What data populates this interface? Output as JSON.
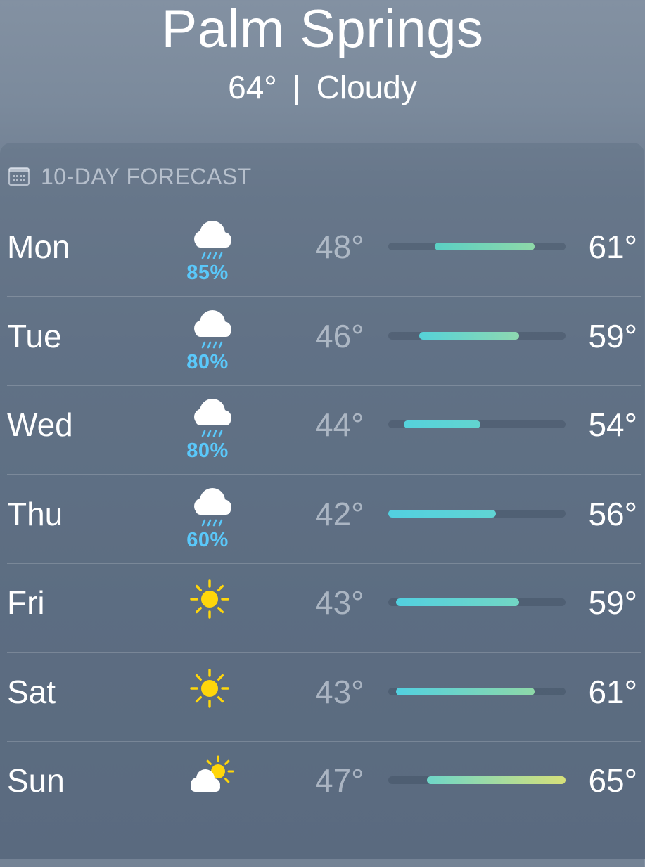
{
  "location": {
    "city": "Palm Springs",
    "temp": "64°",
    "separator": "|",
    "condition": "Cloudy"
  },
  "forecast": {
    "title": "10-DAY FORECAST",
    "title_icon": "calendar-icon",
    "range_low": 42,
    "range_high": 65,
    "days": [
      {
        "day": "Mon",
        "icon": "cloud-rain-icon",
        "precip": "85%",
        "low": "48°",
        "high": "61°",
        "low_val": 48,
        "high_val": 61,
        "colors": [
          "#5ad0c4",
          "#8ed8a8"
        ]
      },
      {
        "day": "Tue",
        "icon": "cloud-rain-icon",
        "precip": "80%",
        "low": "46°",
        "high": "59°",
        "low_val": 46,
        "high_val": 59,
        "colors": [
          "#55d2d8",
          "#8ed8b0"
        ]
      },
      {
        "day": "Wed",
        "icon": "cloud-rain-icon",
        "precip": "80%",
        "low": "44°",
        "high": "54°",
        "low_val": 44,
        "high_val": 54,
        "colors": [
          "#55d2dc",
          "#62d4d0"
        ]
      },
      {
        "day": "Thu",
        "icon": "cloud-rain-icon",
        "precip": "60%",
        "low": "42°",
        "high": "56°",
        "low_val": 42,
        "high_val": 56,
        "colors": [
          "#52d0e0",
          "#60d4d4"
        ]
      },
      {
        "day": "Fri",
        "icon": "sun-icon",
        "precip": "",
        "low": "43°",
        "high": "59°",
        "low_val": 43,
        "high_val": 59,
        "colors": [
          "#52d0e0",
          "#72d6c4"
        ]
      },
      {
        "day": "Sat",
        "icon": "sun-icon",
        "precip": "",
        "low": "43°",
        "high": "61°",
        "low_val": 43,
        "high_val": 61,
        "colors": [
          "#52d0e0",
          "#8ed8a8"
        ]
      },
      {
        "day": "Sun",
        "icon": "partly-sunny-icon",
        "precip": "",
        "low": "47°",
        "high": "65°",
        "low_val": 47,
        "high_val": 65,
        "colors": [
          "#6ed6c8",
          "#d6e07a"
        ]
      }
    ]
  }
}
